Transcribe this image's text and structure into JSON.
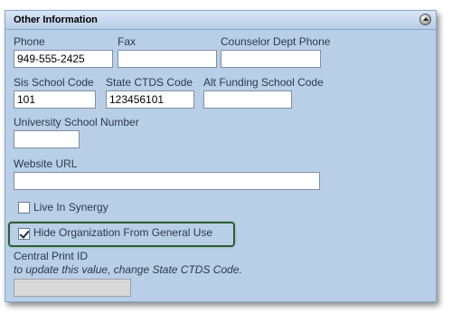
{
  "section": {
    "title": "Other Information"
  },
  "fields": {
    "phone": {
      "label": "Phone",
      "value": "949-555-2425"
    },
    "fax": {
      "label": "Fax",
      "value": ""
    },
    "counselor_phone": {
      "label": "Counselor Dept Phone",
      "value": ""
    },
    "sis_school_code": {
      "label": "Sis School Code",
      "value": "101"
    },
    "state_ctds_code": {
      "label": "State CTDS Code",
      "value": "123456101"
    },
    "alt_funding_code": {
      "label": "Alt Funding School Code",
      "value": ""
    },
    "university_school_number": {
      "label": "University School Number",
      "value": ""
    },
    "website_url": {
      "label": "Website URL",
      "value": ""
    },
    "central_print_id": {
      "label": "Central Print ID",
      "note": "to update this value, change State CTDS Code.",
      "value": ""
    }
  },
  "checkboxes": {
    "live_in_synergy": {
      "label": "Live In Synergy",
      "checked": false
    },
    "hide_organization": {
      "label": "Hide Organization From General Use",
      "checked": true
    }
  },
  "colors": {
    "panel_bg": "#b9cfe8",
    "header_bg": "#c9daef",
    "highlight_border": "#2e5b36"
  }
}
